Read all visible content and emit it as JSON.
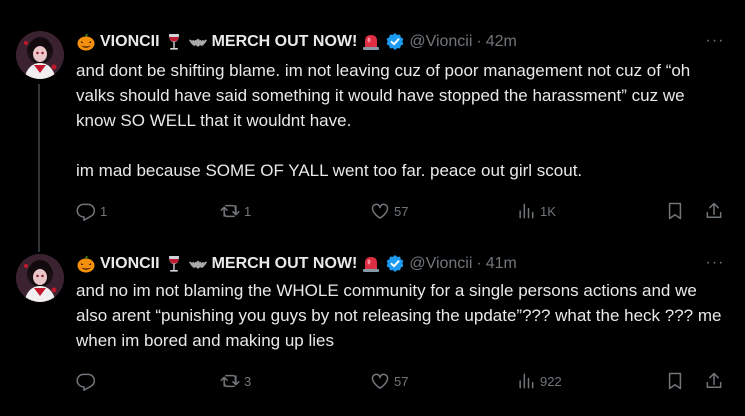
{
  "tweets": [
    {
      "display_name_text": "VIONCII",
      "display_name_suffix": "MERCH OUT NOW!",
      "name_emojis": [
        "jack-o-lantern-icon",
        "wine-glass-icon",
        "bat-icon",
        "siren-icon"
      ],
      "verified_icon": "verified-badge-icon",
      "handle": "@Vioncii",
      "separator": "·",
      "time": "42m",
      "text": "and dont be shifting blame. im not leaving cuz of poor management not cuz of “oh valks should have said something it would have stopped the harassment” cuz we know SO WELL that it wouldnt have.\n\nim mad because SOME OF YALL went too far. peace out girl scout.",
      "actions": {
        "replies": "1",
        "reposts": "1",
        "likes": "57",
        "views": "1K"
      }
    },
    {
      "display_name_text": "VIONCII",
      "display_name_suffix": "MERCH OUT NOW!",
      "name_emojis": [
        "jack-o-lantern-icon",
        "wine-glass-icon",
        "bat-icon",
        "siren-icon"
      ],
      "verified_icon": "verified-badge-icon",
      "handle": "@Vioncii",
      "separator": "·",
      "time": "41m",
      "text": "and no im not blaming the WHOLE community for a single persons actions and we also arent “punishing you guys by not releasing the update”??? what the heck ??? me when im bored and making up lies",
      "actions": {
        "replies": "",
        "reposts": "3",
        "likes": "57",
        "views": "922"
      }
    }
  ],
  "more_label": "···",
  "colors": {
    "background": "#000000",
    "text": "#e7e9ea",
    "secondary": "#71767b",
    "verified": "#1d9bf0",
    "thread_line": "#333639"
  }
}
